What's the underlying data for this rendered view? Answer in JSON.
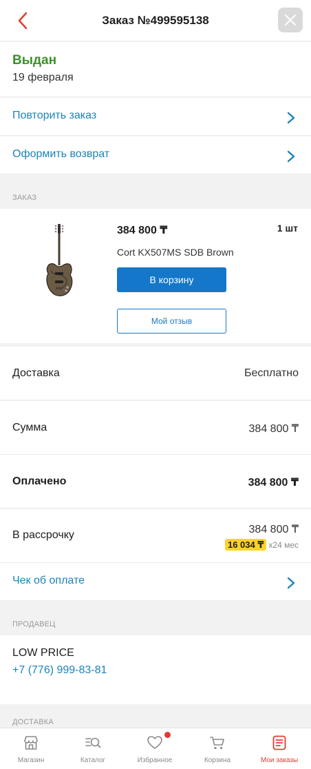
{
  "header": {
    "title": "Заказ №499595138"
  },
  "status": {
    "label": "Выдан",
    "date": "19 февраля"
  },
  "actions": {
    "repeat": "Повторить заказ",
    "return": "Оформить возврат"
  },
  "sections": {
    "order": "ЗАКАЗ",
    "seller": "ПРОДАВЕЦ",
    "delivery": "ДОСТАВКА"
  },
  "product": {
    "price": "384 800 ₸",
    "quantity": "1 шт",
    "name": "Cort KX507MS SDB Brown",
    "cart_button": "В корзину",
    "review_button": "Мой отзыв"
  },
  "summary": {
    "delivery_label": "Доставка",
    "delivery_value": "Бесплатно",
    "sum_label": "Сумма",
    "sum_value": "384 800 ₸",
    "paid_label": "Оплачено",
    "paid_value": "384 800 ₸",
    "installment_label": "В рассрочку",
    "installment_value": "384 800 ₸",
    "installment_monthly": "16 034 ₸",
    "installment_term": "x24 мес",
    "receipt_label": "Чек об оплате"
  },
  "seller": {
    "name": "LOW PRICE",
    "phone": "+7 (776) 999-83-81"
  },
  "tabs": [
    {
      "label": "Магазин",
      "icon": "shop-icon"
    },
    {
      "label": "Каталог",
      "icon": "catalog-search-icon"
    },
    {
      "label": "Избранное",
      "icon": "heart-icon"
    },
    {
      "label": "Корзина",
      "icon": "cart-icon"
    },
    {
      "label": "Мои заказы",
      "icon": "orders-icon"
    }
  ],
  "colors": {
    "accent": "#1477c9",
    "link": "#1c83b8",
    "status_green": "#3d8f2c",
    "active_tab": "#e03c30",
    "badge_yellow": "#ffd325"
  }
}
